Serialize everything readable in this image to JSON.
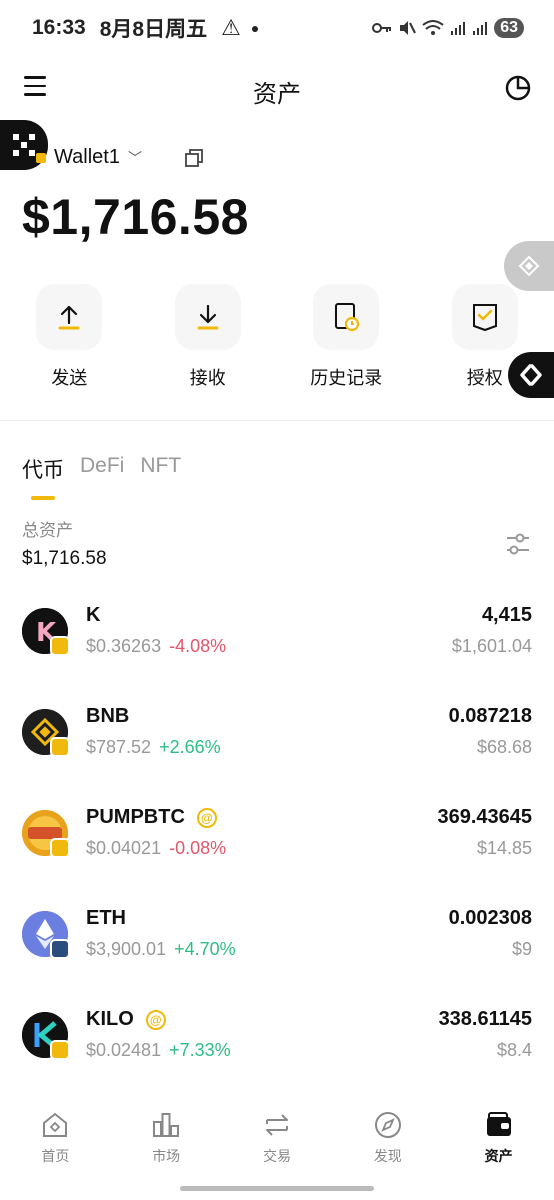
{
  "status_bar": {
    "time": "16:33",
    "date": "8月8日周五",
    "battery": "63"
  },
  "header": {
    "title": "资产"
  },
  "wallet": {
    "name": "Wallet1",
    "balance": "$1,716.58"
  },
  "actions": [
    {
      "label": "发送",
      "icon": "arrow-up-icon"
    },
    {
      "label": "接收",
      "icon": "arrow-down-icon"
    },
    {
      "label": "历史记录",
      "icon": "history-icon"
    },
    {
      "label": "授权",
      "icon": "authorize-icon"
    }
  ],
  "tabs": [
    {
      "label": "代币",
      "active": true
    },
    {
      "label": "DeFi",
      "active": false
    },
    {
      "label": "NFT",
      "active": false
    }
  ],
  "total": {
    "label": "总资产",
    "value": "$1,716.58"
  },
  "tokens": [
    {
      "symbol": "K",
      "price": "$0.36263",
      "change": "-4.08%",
      "dir": "down",
      "amount": "4,415",
      "value": "$1,601.04",
      "badge": false,
      "logo_color": "#111111",
      "chain_color": "#f0b90b"
    },
    {
      "symbol": "BNB",
      "price": "$787.52",
      "change": "+2.66%",
      "dir": "up",
      "amount": "0.087218",
      "value": "$68.68",
      "badge": false,
      "logo_color": "#1e1e1e",
      "chain_color": "#f0b90b"
    },
    {
      "symbol": "PUMPBTC",
      "price": "$0.04021",
      "change": "-0.08%",
      "dir": "down",
      "amount": "369.43645",
      "value": "$14.85",
      "badge": true,
      "logo_color": "#e9a21c",
      "chain_color": "#f0b90b"
    },
    {
      "symbol": "ETH",
      "price": "$3,900.01",
      "change": "+4.70%",
      "dir": "up",
      "amount": "0.002308",
      "value": "$9",
      "badge": false,
      "logo_color": "#6b7fe0",
      "chain_color": "#2b4d7d"
    },
    {
      "symbol": "KILO",
      "price": "$0.02481",
      "change": "+7.33%",
      "dir": "up",
      "amount": "338.61145",
      "value": "$8.4",
      "badge": true,
      "logo_color": "#111111",
      "chain_color": "#f0b90b"
    }
  ],
  "bottom_nav": [
    {
      "label": "首页",
      "icon": "home-icon",
      "active": false
    },
    {
      "label": "市场",
      "icon": "market-icon",
      "active": false
    },
    {
      "label": "交易",
      "icon": "swap-icon",
      "active": false
    },
    {
      "label": "发现",
      "icon": "compass-icon",
      "active": false
    },
    {
      "label": "资产",
      "icon": "wallet-icon",
      "active": true
    }
  ],
  "colors": {
    "accent": "#f0b90b",
    "up": "#2ebd85",
    "down": "#e0566b"
  }
}
